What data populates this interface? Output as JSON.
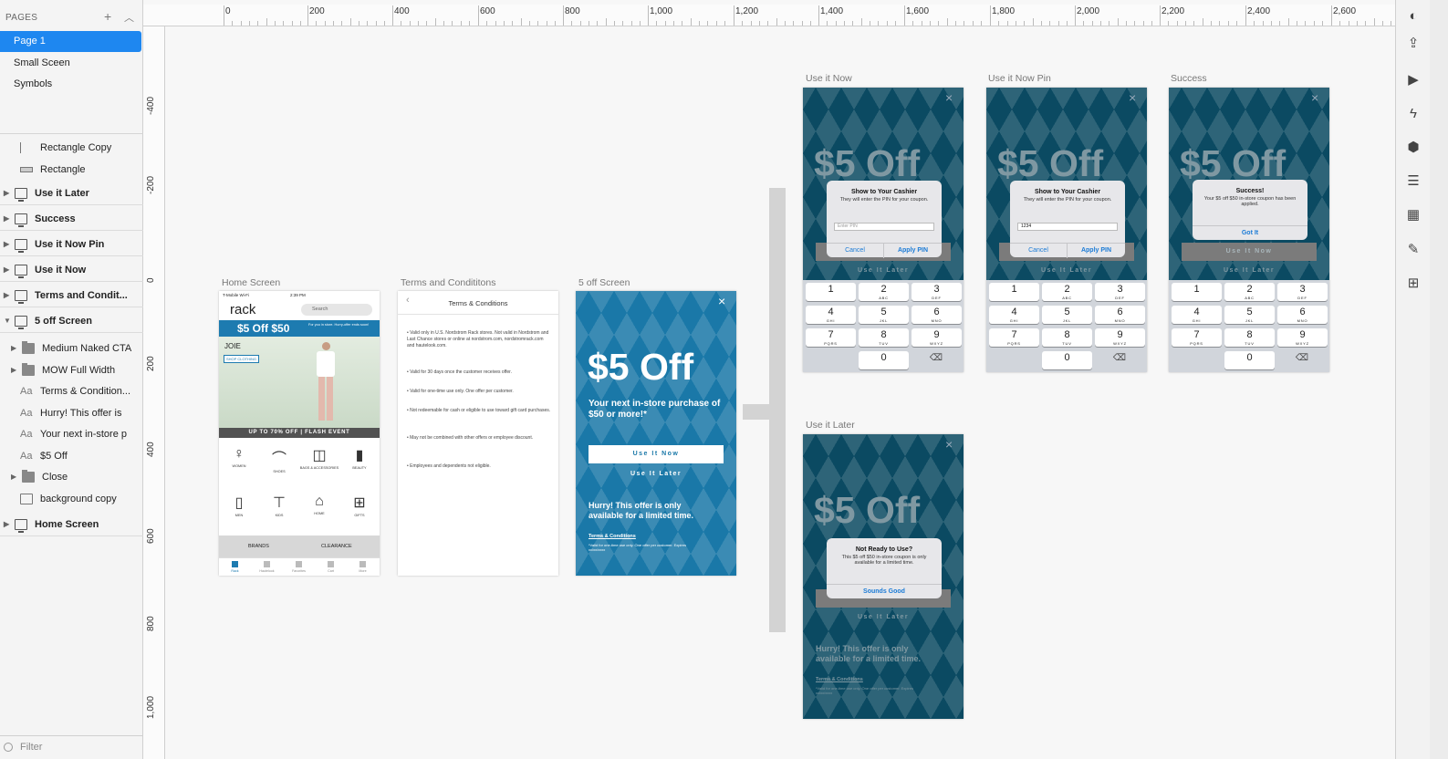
{
  "pages_panel": {
    "title": "PAGES",
    "add_icon": "+",
    "collapse_icon": "^",
    "pages": [
      "Page 1",
      "Small Sceen",
      "Symbols"
    ],
    "selected_page": "Page 1"
  },
  "layers": [
    {
      "name": "Rectangle Copy",
      "icon": "line-icon"
    },
    {
      "name": "Rectangle",
      "icon": "rectangle-icon"
    },
    {
      "name": "Use it Later",
      "icon": "artboard-icon",
      "artboard": true
    },
    {
      "name": "Success",
      "icon": "artboard-icon",
      "artboard": true
    },
    {
      "name": "Use it Now Pin",
      "icon": "artboard-icon",
      "artboard": true
    },
    {
      "name": "Use it Now",
      "icon": "artboard-icon",
      "artboard": true
    },
    {
      "name": "Terms and Condit...",
      "icon": "artboard-icon",
      "artboard": true
    },
    {
      "name": "5 off Screen",
      "icon": "artboard-icon",
      "artboard": true,
      "expanded": true
    },
    {
      "name": "Medium Naked CTA",
      "icon": "folder-icon"
    },
    {
      "name": "MOW Full Width",
      "icon": "folder-icon"
    },
    {
      "name": "Terms & Condition...",
      "icon": "text-icon"
    },
    {
      "name": "Hurry! This offer is",
      "icon": "text-icon"
    },
    {
      "name": "Your next in-store p",
      "icon": "text-icon"
    },
    {
      "name": "$5 Off",
      "icon": "text-icon"
    },
    {
      "name": "Close",
      "icon": "folder-icon"
    },
    {
      "name": "background copy",
      "icon": "image-icon"
    },
    {
      "name": "Home Screen",
      "icon": "artboard-icon",
      "artboard": true
    }
  ],
  "filter_placeholder": "Filter",
  "ruler": {
    "top": [
      "0",
      "200",
      "400",
      "600",
      "800",
      "1,000",
      "1,200",
      "1,400",
      "1,600",
      "1,800",
      "2,000",
      "2,200",
      "2,400",
      "2,600"
    ],
    "left": [
      "-400",
      "-200",
      "0",
      "200",
      "400",
      "600",
      "800",
      "1,000"
    ]
  },
  "artboards": {
    "home": {
      "title": "Home Screen",
      "status_carrier": "T-Mobile Wi-Fi",
      "status_time": "2:39 PM",
      "logo": "rack",
      "search": "Search",
      "banner_main": "$5 Off $50",
      "banner_sub": "For you in store. Hurry-offer ends soon!",
      "brand": "JOIE",
      "shop_cta": "SHOP CLOTHING",
      "promo_strip": "UP TO 70% OFF | FLASH EVENT",
      "categories": [
        "WOMEN",
        "SHOES",
        "BAGS & ACCESSORIES",
        "BEAUTY",
        "MEN",
        "KIDS",
        "HOME",
        "GIFTS"
      ],
      "category_icons": [
        "dress-icon",
        "shoe-icon",
        "bag-icon",
        "lipstick-icon",
        "shirt-icon",
        "tshirt-icon",
        "lamp-icon",
        "gift-icon"
      ],
      "bottom_links": [
        "BRANDS",
        "CLEARANCE"
      ],
      "tabbar": [
        "Rack",
        "Hautelook",
        "Favorites",
        "Cart",
        "More"
      ]
    },
    "terms": {
      "title": "Terms and Condititons",
      "header": "Terms & Conditions",
      "bullets": [
        "Valid only in U.S. Nordstrom Rack stores. Not valid in Nordstrom and Last Chance stores or online at nordstrom.com, nordstromrack.com and hautelook.com.",
        "Valid for 30 days once the customer receives offer.",
        "Valid for one-time use only. One offer per customer.",
        "Not redeemable for cash or eligible to use toward gift card purchases.",
        "May not be combined with other offers or employee discount.",
        "Employees and dependents not eligible."
      ]
    },
    "five_off": {
      "title": "5 off Screen",
      "headline": "$5 Off",
      "subline": "Your next in-store purchase of $50 or more!*",
      "primary_cta": "Use It Now",
      "secondary_cta": "Use It Later",
      "hurry": "Hurry! This offer is only available for a limited time.",
      "terms_link": "Terms & Conditions",
      "fine_print": "*Valid for one-time use only. One offer per customer. Expires xx/xx/xxxx"
    },
    "use_now": {
      "title": "Use it Now",
      "dialog_title": "Show to Your Cashier",
      "dialog_body": "They will enter the PIN for your coupon.",
      "input_placeholder": "Enter PIN",
      "cancel": "Cancel",
      "apply": "Apply PIN",
      "secondary_cta": "Use It Later"
    },
    "use_now_pin": {
      "title": "Use it Now Pin",
      "dialog_title": "Show to Your Cashier",
      "dialog_body": "They will enter the PIN for your coupon.",
      "input_value": "1234",
      "cancel": "Cancel",
      "apply": "Apply PIN",
      "secondary_cta": "Use It Later"
    },
    "success": {
      "title": "Success",
      "dialog_title": "Success!",
      "dialog_body": "Your $5 off $50 in-store coupon has been applied.",
      "confirm": "Got It",
      "primary_cta": "Use It Now",
      "secondary_cta": "Use It Later"
    },
    "use_later": {
      "title": "Use it Later",
      "dialog_title": "Not Ready to Use?",
      "dialog_body": "This $5 off $50 in-store coupon is only available for a limited time.",
      "confirm": "Sounds Good",
      "secondary_cta": "Use It Later",
      "hurry": "Hurry! This offer is only available for a limited time.",
      "terms_link": "Terms & Conditions",
      "fine_print": "*Valid for one-time use only. One offer per customer. Expires xx/xx/xxxx"
    },
    "shared_headline": "$5 Off"
  },
  "keypad": [
    {
      "n": "1",
      "l": ""
    },
    {
      "n": "2",
      "l": "ABC"
    },
    {
      "n": "3",
      "l": "DEF"
    },
    {
      "n": "4",
      "l": "GHI"
    },
    {
      "n": "5",
      "l": "JKL"
    },
    {
      "n": "6",
      "l": "MNO"
    },
    {
      "n": "7",
      "l": "PQRS"
    },
    {
      "n": "8",
      "l": "TUV"
    },
    {
      "n": "9",
      "l": "WXYZ"
    },
    {
      "n": "0",
      "l": ""
    }
  ],
  "right_toolbar": [
    "component-icon",
    "export-icon",
    "play-icon",
    "bolt-icon",
    "hexagon-icon",
    "list-icon",
    "layout-icon",
    "edit-image-icon",
    "add-image-icon"
  ],
  "colors": {
    "accent": "#1e87f0",
    "teal": "#0b4a62",
    "coupon_blue": "#1a78a8"
  }
}
